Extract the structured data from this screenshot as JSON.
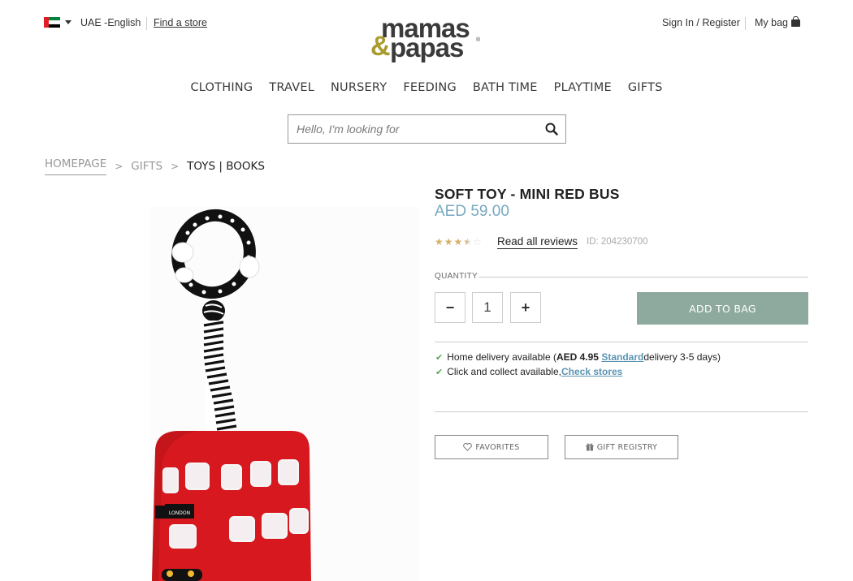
{
  "header": {
    "locale": "UAE -English",
    "find_store": "Find a store",
    "sign_in": "Sign In / Register",
    "my_bag": "My bag",
    "logo_line1": "mamas",
    "logo_amp": "&",
    "logo_line2": "papas",
    "logo_reg": "®"
  },
  "nav": {
    "items": [
      "CLOTHING",
      "TRAVEL",
      "NURSERY",
      "FEEDING",
      "BATH TIME",
      "PLAYTIME",
      "GIFTS"
    ]
  },
  "search": {
    "placeholder": "Hello, I'm looking for"
  },
  "breadcrumb": {
    "items": [
      "HOMEPAGE",
      "GIFTS",
      "TOYS | BOOKS"
    ]
  },
  "product": {
    "title": "SOFT TOY - MINI RED BUS",
    "price": "AED 59.00",
    "rating": 3.5,
    "rating_max": 5,
    "reviews_link": "Read all reviews",
    "id_text": "ID: 204230700",
    "quantity_label": "QUANTITY",
    "quantity_value": "1",
    "minus_label": "−",
    "plus_label": "+",
    "add_to_bag": "ADD TO BAG",
    "delivery_prefix": "Home delivery available (",
    "delivery_price": "AED 4.95",
    "delivery_link": "Standard",
    "delivery_suffix": " delivery 3-5 days)",
    "collect_prefix": "Click and collect available, ",
    "collect_link": "Check stores",
    "favorites": "FAVORITES",
    "gift_registry": "GIFT REGISTRY",
    "bus_sign": "LONDON"
  },
  "colors": {
    "price": "#77a8c0",
    "add_to_bag_bg": "#8eaa9e",
    "star": "#d4b06a",
    "link": "#5c94b3",
    "check": "#5aa85a",
    "logo_amp": "#a99c2d"
  }
}
